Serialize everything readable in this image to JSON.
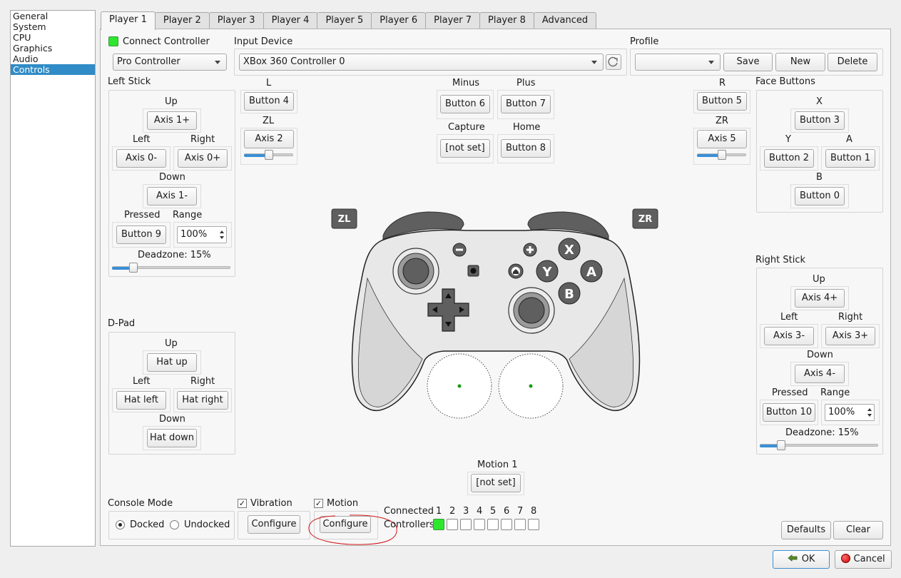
{
  "sidebar": {
    "items": [
      "General",
      "System",
      "CPU",
      "Graphics",
      "Audio",
      "Controls"
    ],
    "selected_index": 5
  },
  "tabs": [
    "Player 1",
    "Player 2",
    "Player 3",
    "Player 4",
    "Player 5",
    "Player 6",
    "Player 7",
    "Player 8",
    "Advanced"
  ],
  "active_tab": 0,
  "connect_controller": {
    "label": "Connect Controller",
    "checked": true,
    "indicator_color": "#2ee62e"
  },
  "controller_type": {
    "value": "Pro Controller"
  },
  "input_device": {
    "title": "Input Device",
    "value": "XBox 360 Controller 0",
    "refresh_icon": "refresh-icon"
  },
  "profile": {
    "title": "Profile",
    "value": "",
    "save": "Save",
    "new": "New",
    "delete": "Delete"
  },
  "left_stick": {
    "title": "Left Stick",
    "up_label": "Up",
    "up": "Axis 1+",
    "left_label": "Left",
    "left": "Axis 0-",
    "right_label": "Right",
    "right": "Axis 0+",
    "down_label": "Down",
    "down": "Axis 1-",
    "pressed_label": "Pressed",
    "pressed": "Button 9",
    "range_label": "Range",
    "range": "100%",
    "deadzone": "Deadzone: 15%",
    "deadzone_value": 0.15
  },
  "shoulder_l": {
    "l_label": "L",
    "l": "Button 4",
    "zl_label": "ZL",
    "zl": "Axis 2",
    "zl_threshold": 0.5
  },
  "shoulder_r": {
    "r_label": "R",
    "r": "Button 5",
    "zr_label": "ZR",
    "zr": "Axis 5",
    "zr_threshold": 0.5
  },
  "center_buttons": {
    "minus_label": "Minus",
    "minus": "Button 6",
    "plus_label": "Plus",
    "plus": "Button 7",
    "capture_label": "Capture",
    "capture": "[not set]",
    "home_label": "Home",
    "home": "Button 8"
  },
  "face_buttons": {
    "title": "Face Buttons",
    "x_label": "X",
    "x": "Button 3",
    "y_label": "Y",
    "y": "Button 2",
    "a_label": "A",
    "a": "Button 1",
    "b_label": "B",
    "b": "Button 0"
  },
  "dpad": {
    "title": "D-Pad",
    "up_label": "Up",
    "up": "Hat up",
    "left_label": "Left",
    "left": "Hat left",
    "right_label": "Right",
    "right": "Hat right",
    "down_label": "Down",
    "down": "Hat down"
  },
  "right_stick": {
    "title": "Right Stick",
    "up_label": "Up",
    "up": "Axis 4+",
    "left_label": "Left",
    "left": "Axis 3-",
    "right_label": "Right",
    "right": "Axis 3+",
    "down_label": "Down",
    "down": "Axis 4-",
    "pressed_label": "Pressed",
    "pressed": "Button 10",
    "range_label": "Range",
    "range": "100%",
    "deadzone": "Deadzone: 15%",
    "deadzone_value": 0.15
  },
  "controller_image": {
    "zl": "ZL",
    "zr": "ZR",
    "x": "X",
    "y": "Y",
    "a": "A",
    "b": "B"
  },
  "motion": {
    "label": "Motion 1",
    "value": "[not set]"
  },
  "console_mode": {
    "title": "Console Mode",
    "docked": "Docked",
    "undocked": "Undocked",
    "selected": "Docked"
  },
  "vibration": {
    "label": "Vibration",
    "checked": true,
    "configure": "Configure"
  },
  "motion_toggle": {
    "label": "Motion",
    "checked": true,
    "configure": "Configure"
  },
  "connected": {
    "label_line1": "Connected",
    "label_line2": "Controllers",
    "slots": [
      "1",
      "2",
      "3",
      "4",
      "5",
      "6",
      "7",
      "8"
    ],
    "active": [
      true,
      false,
      false,
      false,
      false,
      false,
      false,
      false
    ]
  },
  "defaults_button": "Defaults",
  "clear_button": "Clear",
  "ok_button": "OK",
  "cancel_button": "Cancel"
}
